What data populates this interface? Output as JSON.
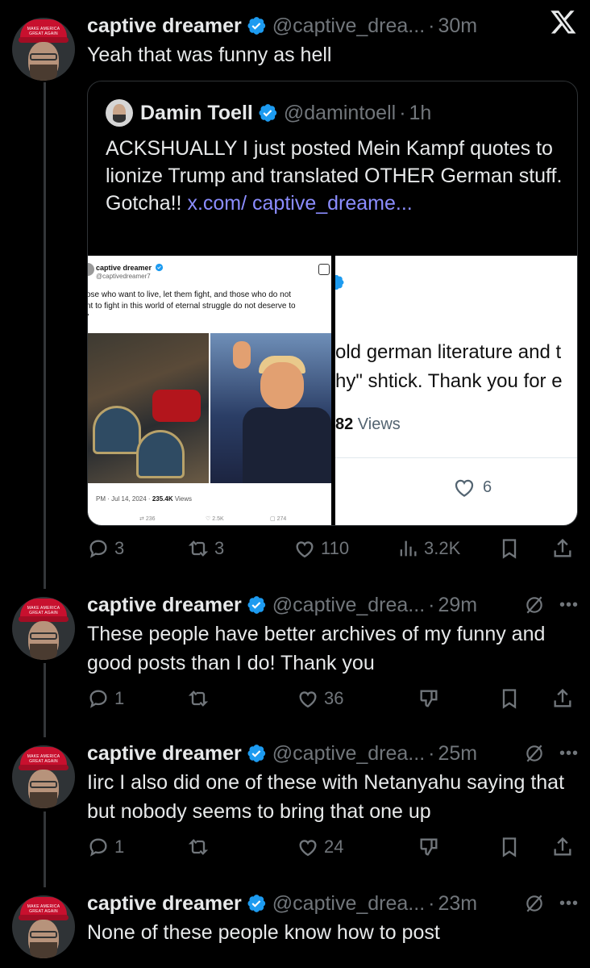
{
  "thread": [
    {
      "name": "captive dreamer",
      "handle": "@captive_drea...",
      "time": "30m",
      "text": "Yeah that was funny as hell",
      "replies": "3",
      "reposts": "3",
      "likes": "110",
      "views": "3.2K"
    },
    {
      "name": "captive dreamer",
      "handle": "@captive_drea...",
      "time": "29m",
      "text": "These people have better archives of my funny and good posts than I do! Thank you",
      "replies": "1",
      "reposts": "",
      "likes": "36"
    },
    {
      "name": "captive dreamer",
      "handle": "@captive_drea...",
      "time": "25m",
      "text": "Iirc I also did one of these with Netanyahu saying that but nobody seems to bring that one up",
      "replies": "1",
      "reposts": "",
      "likes": "24"
    },
    {
      "name": "captive dreamer",
      "handle": "@captive_drea...",
      "time": "23m",
      "text": "None of these people know how to post"
    }
  ],
  "quoted": {
    "name": "Damin Toell",
    "handle": "@damintoell",
    "time": "1h",
    "text": "ACKSHUALLY I just posted Mein Kampf quotes to lionize Trump and translated OTHER German stuff. Gotcha!!",
    "link": "x.com/ captive_dreame..."
  },
  "embedded_left": {
    "name": "captive dreamer",
    "handle": "@captivedreamer7",
    "quote_line1": "ose who want to live, let them fight, and those who do not",
    "quote_line2": "nt to fight in this world of eternal struggle do not deserve to",
    "quote_line3": "\"",
    "meta_time": "PM · Jul 14, 2024 · ",
    "meta_views": "235.4K",
    "meta_views_label": " Views",
    "stat_reposts": "236",
    "stat_likes": "2.5K",
    "stat_bookmarks": "274"
  },
  "embedded_right": {
    "line1": "old german literature and t",
    "line2": "hy\" shtick.  Thank you for e",
    "views_count": "82",
    "views_label": " Views",
    "likes": "6"
  },
  "colors": {
    "background": "#000000",
    "text": "#e7e9ea",
    "muted": "#71767b",
    "verified": "#1d9bf0",
    "link": "#8b8dff"
  },
  "icons": [
    "x-logo-icon",
    "verified-icon",
    "reply-icon",
    "repost-icon",
    "like-icon",
    "views-icon",
    "bookmark-icon",
    "share-icon",
    "grok-icon",
    "more-icon",
    "downvote-icon"
  ]
}
